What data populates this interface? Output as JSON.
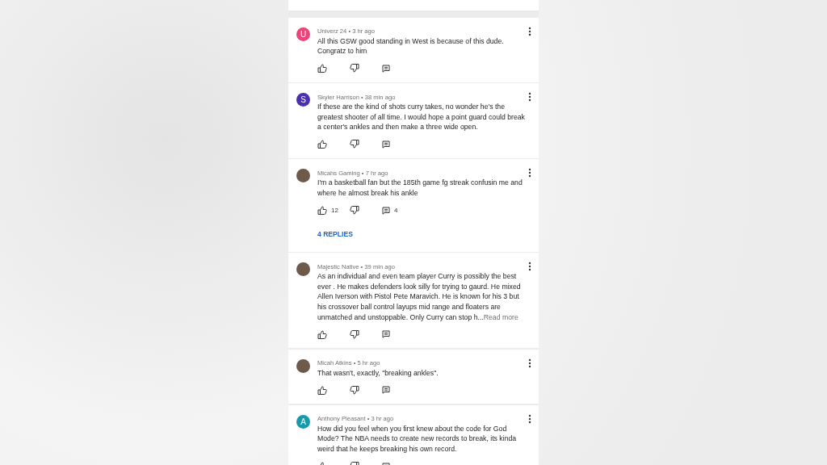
{
  "comments": [
    {
      "meta": "Univerz 24 • 3 hr ago",
      "avatar": {
        "kind": "letter",
        "letter": "U",
        "color": "#e8457a"
      },
      "text": "All this GSW good standing in West  is because of this dude. Congratz to him"
    },
    {
      "meta": "Skyler Harrison • 38 min ago",
      "avatar": {
        "kind": "letter",
        "letter": "S",
        "color": "#4a2fb0"
      },
      "text": "If these are the kind of shots curry takes, no wonder he's the greatest shooter of all time. I would hope a point guard could break a center's ankles and then make a three wide open."
    },
    {
      "meta": "Micahs Gaming • 7 hr ago",
      "avatar": {
        "kind": "photo"
      },
      "text": "I'm a basketball fan but the 185th game fg streak confusin me and where he almost break his ankle",
      "likes": "12",
      "reply_count": "4",
      "replies_link": "4 REPLIES"
    },
    {
      "meta": "Majestic Native • 39 min ago",
      "avatar": {
        "kind": "photo"
      },
      "text": "As an individual and even team player Curry is possibly the best ever . He makes defenders look silly for trying to gaurd. He mixed Allen Iverson with Pistol Pete Maravich. He is known for his 3 but his crossover ball control layups mid range and floaters are unmatched and unstoppable. Only Curry can stop h...",
      "read_more": "Read more"
    },
    {
      "meta": "Micah Atkins • 5 hr ago",
      "avatar": {
        "kind": "photo"
      },
      "text": "That wasn't, exactly, \"breaking ankles\"."
    },
    {
      "meta": "Anthony Pleasant • 3 hr ago",
      "avatar": {
        "kind": "letter",
        "letter": "A",
        "color": "#1a9aa8"
      },
      "text": "How did you feel when you first knew about the code for God Mode? The NBA needs to create new records to break, its kinda weird that he keeps breaking his own record."
    }
  ]
}
